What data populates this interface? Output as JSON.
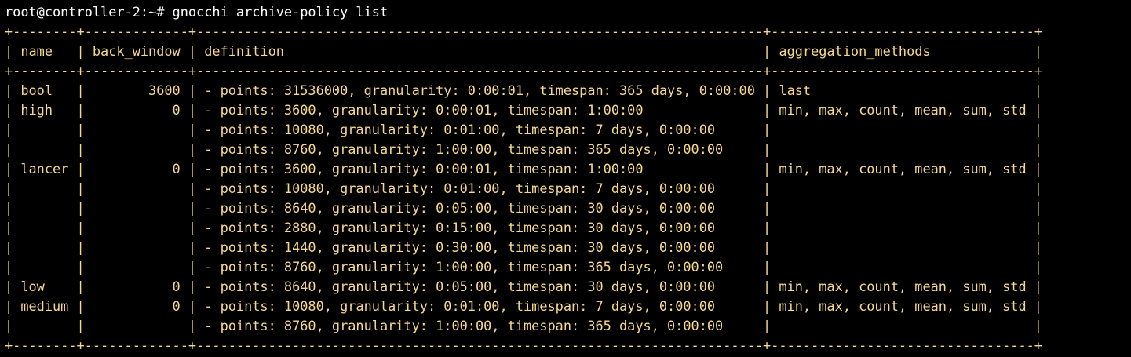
{
  "terminal": {
    "background": "#000000",
    "text_color": "#f5d78e",
    "prompt_color": "#ffffff",
    "lines": [
      "root@controller-2:~# gnocchi archive-policy list",
      "+--------+-------------+-----------------------------------------------------------------------+---------------------------------+",
      "| name   | back_window | definition                                                            | aggregation_methods             |",
      "+--------+-------------+-----------------------------------------------------------------------+---------------------------------+",
      "| bool   |        3600 | - points: 31536000, granularity: 0:00:01, timespan: 365 days, 0:00:00 | last                            |",
      "| high   |           0 | - points: 3600, granularity: 0:00:01, timespan: 1:00:00               | min, max, count, mean, sum, std |",
      "|        |             | - points: 10080, granularity: 0:01:00, timespan: 7 days, 0:00:00      |                                 |",
      "|        |             | - points: 8760, granularity: 1:00:00, timespan: 365 days, 0:00:00     |                                 |",
      "| lancer |           0 | - points: 3600, granularity: 0:00:01, timespan: 1:00:00               | min, max, count, mean, sum, std |",
      "|        |             | - points: 10080, granularity: 0:01:00, timespan: 7 days, 0:00:00      |                                 |",
      "|        |             | - points: 8640, granularity: 0:05:00, timespan: 30 days, 0:00:00      |                                 |",
      "|        |             | - points: 2880, granularity: 0:15:00, timespan: 30 days, 0:00:00      |                                 |",
      "|        |             | - points: 1440, granularity: 0:30:00, timespan: 30 days, 0:00:00      |                                 |",
      "|        |             | - points: 8760, granularity: 1:00:00, timespan: 365 days, 0:00:00     |                                 |",
      "| low    |           0 | - points: 8640, granularity: 0:05:00, timespan: 30 days, 0:00:00      | min, max, count, mean, sum, std |",
      "| medium |           0 | - points: 10080, granularity: 0:01:00, timespan: 7 days, 0:00:00      | min, max, count, mean, sum, std |",
      "|        |             | - points: 8760, granularity: 1:00:00, timespan: 365 days, 0:00:00     |                                 |",
      "+--------+-------------+-----------------------------------------------------------------------+---------------------------------+"
    ]
  }
}
